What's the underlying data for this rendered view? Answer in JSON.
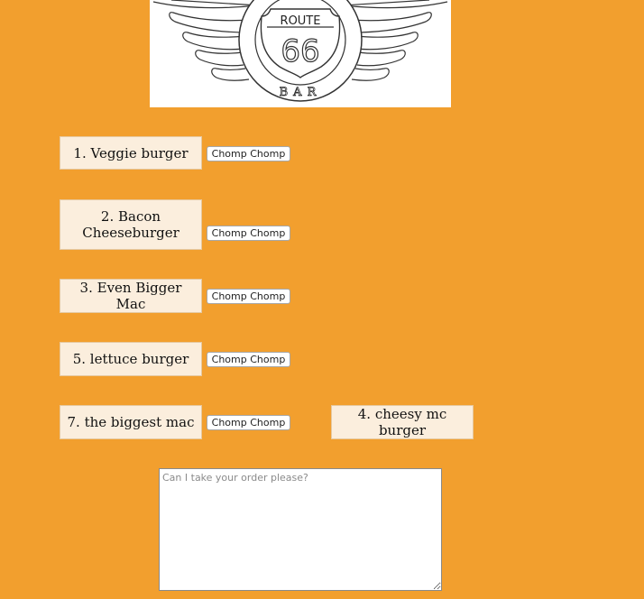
{
  "logo": {
    "sign_text": "ROUTE",
    "sign_number": "66",
    "bottom_text": "BAR"
  },
  "menu": [
    {
      "label": "1. Veggie burger",
      "button": "Chomp Chomp"
    },
    {
      "label": "2. Bacon Cheeseburger",
      "button": "Chomp Chomp"
    },
    {
      "label": "3. Even Bigger Mac",
      "button": "Chomp Chomp"
    },
    {
      "label": "5. lettuce burger",
      "button": "Chomp Chomp"
    },
    {
      "label": "7. the biggest mac",
      "button": "Chomp Chomp"
    }
  ],
  "extra_item": {
    "label": "4. cheesy mc burger"
  },
  "order": {
    "placeholder": "Can I take your order please?",
    "value": ""
  },
  "colors": {
    "background": "#F29F2E",
    "menu_box": "#FBEEDD"
  }
}
